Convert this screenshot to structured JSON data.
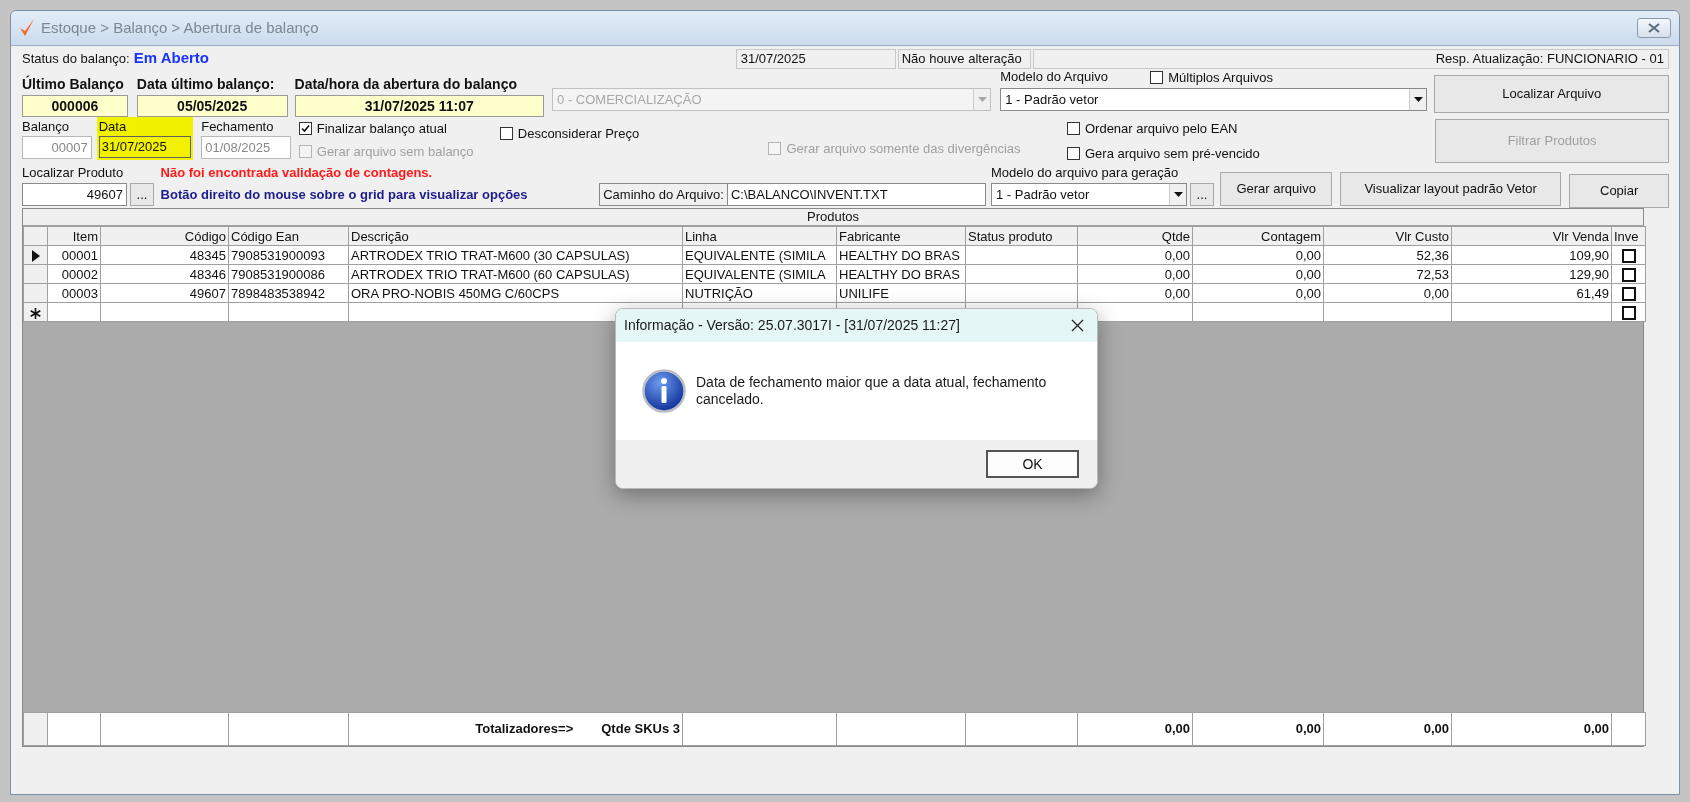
{
  "window": {
    "title": "Estoque > Balanço > Abertura de balanço"
  },
  "status": {
    "label": "Status do balanço:",
    "value": "Em Aberto",
    "date": "31/07/2025",
    "change": "Não houve alteração",
    "responsible": "Resp. Atualização: FUNCIONARIO - 01"
  },
  "summary": [
    {
      "label": "Último Balanço",
      "value": "000006"
    },
    {
      "label": "Data último balanço:",
      "value": "05/05/2025"
    },
    {
      "label": "Data/hora da abertura do balanço",
      "value": "31/07/2025 11:07"
    }
  ],
  "category_combo": {
    "value": "0 - COMERCIALIZAÇÃO",
    "disabled": true
  },
  "file_model": {
    "label": "Modelo do Arquivo",
    "value": "1 - Padrão vetor"
  },
  "multiple_files": {
    "label": "Múltiplos Arquivos",
    "checked": false
  },
  "locate_file_button": {
    "label": "Localizar Arquivo",
    "disabled": false
  },
  "balance": {
    "label": "Balanço",
    "value": "00007",
    "disabled": true
  },
  "date": {
    "label": "Data",
    "value": "31/07/2025"
  },
  "closing": {
    "label": "Fechamento",
    "value": "01/08/2025",
    "disabled": true
  },
  "options": [
    {
      "label": "Finalizar balanço atual",
      "checked": true,
      "disabled": false
    },
    {
      "label": "Gerar arquivo sem balanço",
      "checked": false,
      "disabled": true
    },
    {
      "label": "Desconsiderar Preço",
      "checked": false,
      "disabled": false
    },
    {
      "label": "Gerar arquivo somente das divergências",
      "checked": false,
      "disabled": true
    },
    {
      "label": "Ordenar arquivo pelo EAN",
      "checked": false,
      "disabled": false
    },
    {
      "label": "Gera arquivo sem pré-vencido",
      "checked": false,
      "disabled": false
    }
  ],
  "filter_button": {
    "label": "Filtrar Produtos",
    "disabled": true
  },
  "find_product": {
    "label": "Localizar Produto",
    "value": "49607",
    "browse": "..."
  },
  "warning": "Não foi encontrada validação de contagens.",
  "hint": "Botão direito do mouse sobre o grid para visualizar opções",
  "file_path": {
    "label": "Caminho do Arquivo:",
    "value": "C:\\BALANCO\\INVENT.TXT"
  },
  "generation_model": {
    "label": "Modelo do arquivo para geração",
    "value": "1 - Padrão vetor",
    "browse": "..."
  },
  "buttons": [
    {
      "label": "Gerar arquivo"
    },
    {
      "label": "Visualizar layout padrão Vetor"
    },
    {
      "label": "Copiar"
    }
  ],
  "table": {
    "title": "Produtos",
    "columns": [
      "Item",
      "Código",
      "Código Ean",
      "Descrição",
      "Linha",
      "Fabricante",
      "Status produto",
      "Qtde",
      "Contagem",
      "Vlr Custo",
      "Vlr Venda",
      "Inve"
    ],
    "rows": [
      {
        "selected": true,
        "item": "00001",
        "code": "48345",
        "ean": "7908531900093",
        "description": "ARTRODEX TRIO TRAT-M600 (30 CAPSULAS)",
        "line": "EQUIVALENTE (SIMILA",
        "manufacturer": "HEALTHY DO BRAS",
        "qty": "0,00",
        "count": "0,00",
        "cost": "52,36",
        "price": "109,90",
        "inve": false
      },
      {
        "selected": false,
        "item": "00002",
        "code": "48346",
        "ean": "7908531900086",
        "description": "ARTRODEX TRIO TRAT-M600 (60 CAPSULAS)",
        "line": "EQUIVALENTE (SIMILA",
        "manufacturer": "HEALTHY DO BRAS",
        "qty": "0,00",
        "count": "0,00",
        "cost": "72,53",
        "price": "129,90",
        "inve": false
      },
      {
        "selected": false,
        "item": "00003",
        "code": "49607",
        "ean": "7898483538942",
        "description": "ORA PRO-NOBIS 450MG C/60CPS",
        "line": "NUTRIÇÃO",
        "manufacturer": "UNILIFE",
        "qty": "0,00",
        "count": "0,00",
        "cost": "0,00",
        "price": "61,49",
        "inve": false
      }
    ],
    "new_row": {
      "inve": false
    },
    "totals": {
      "label": "Totalizadores=>",
      "skus": "Qtde SKUs 3",
      "qty": "0,00",
      "count": "0,00",
      "cost": "0,00",
      "price": "0,00"
    }
  },
  "dialog": {
    "title": "Informação - Versão: 25.07.3017I - [31/07/2025 11:27]",
    "message": "Data de fechamento maior que a data atual, fechamento cancelado.",
    "button": "OK"
  }
}
